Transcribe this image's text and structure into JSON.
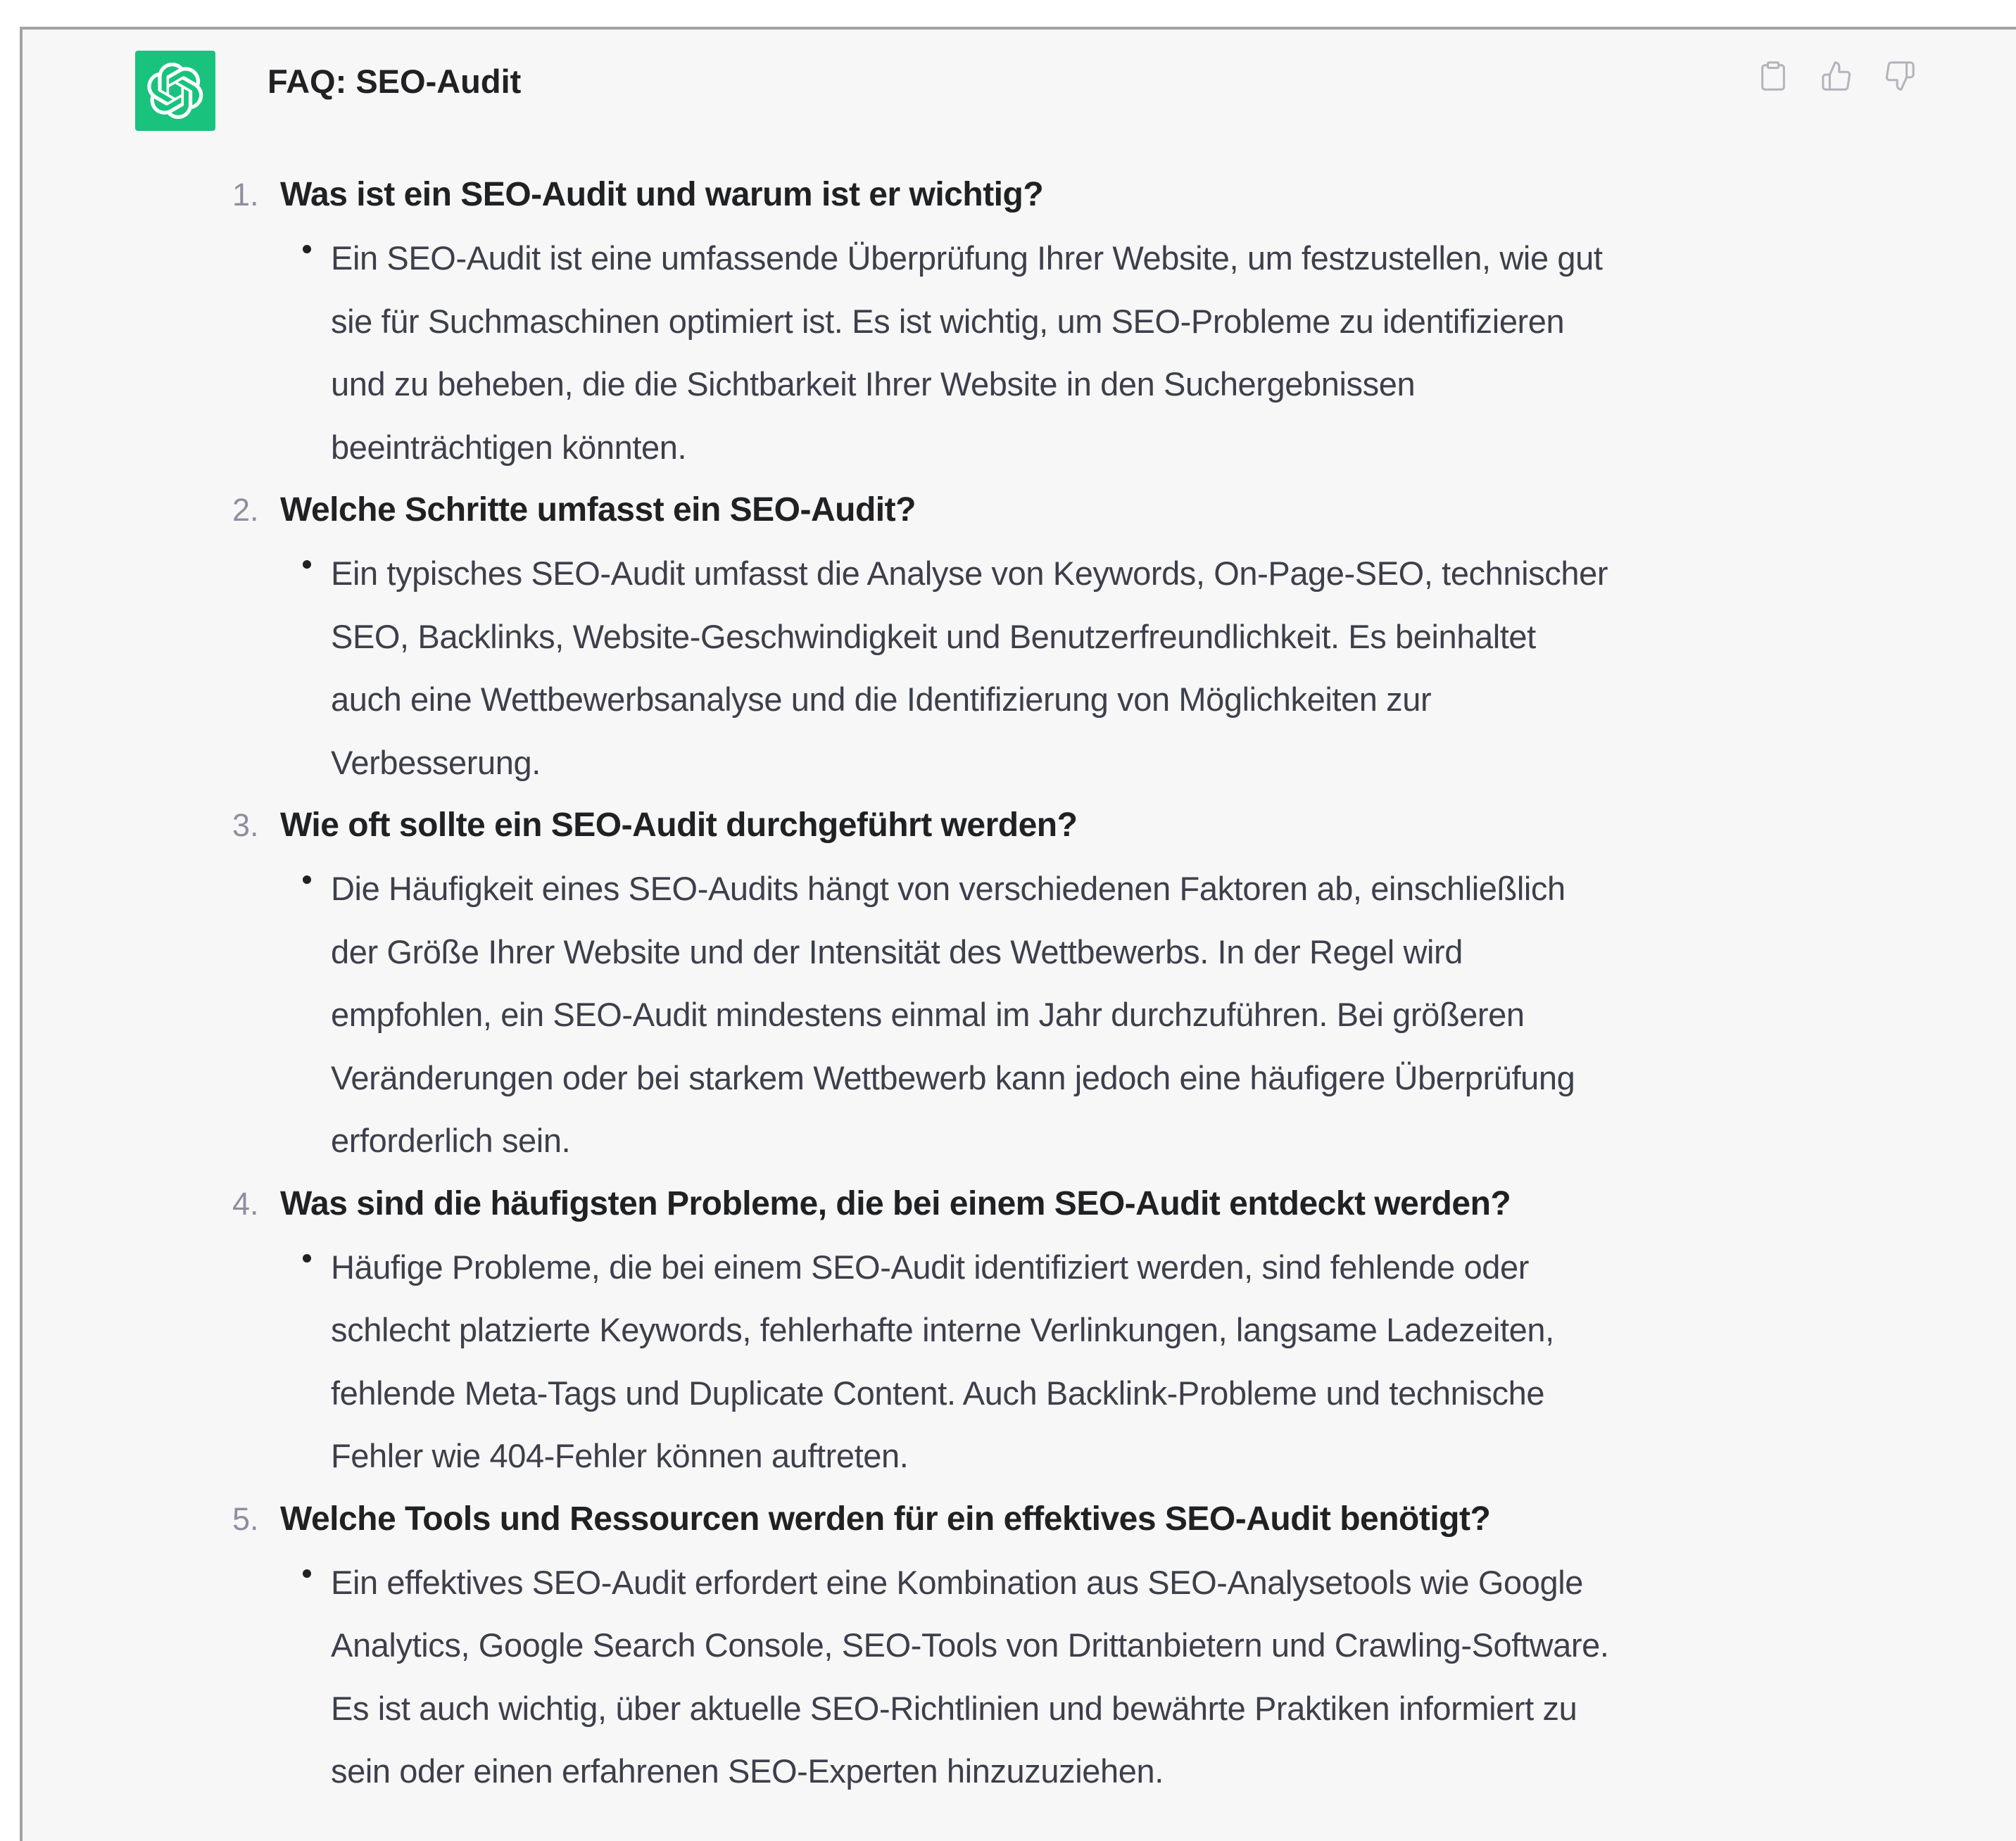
{
  "header": {
    "title": "FAQ: SEO-Audit",
    "avatar_icon": "openai-logo-icon",
    "avatar_color": "#19c37d",
    "actions": [
      {
        "icon": "clipboard-icon"
      },
      {
        "icon": "thumbs-up-icon"
      },
      {
        "icon": "thumbs-down-icon"
      }
    ]
  },
  "faq": [
    {
      "number": "1.",
      "question": "Was ist ein SEO-Audit und warum ist er wichtig?",
      "answer_lines": [
        "Ein SEO-Audit ist eine umfassende Überprüfung Ihrer Website, um festzustellen, wie gut",
        "sie für Suchmaschinen optimiert ist. Es ist wichtig, um SEO-Probleme zu identifizieren",
        "und zu beheben, die die Sichtbarkeit Ihrer Website in den Suchergebnissen",
        "beeinträchtigen könnten."
      ]
    },
    {
      "number": "2.",
      "question": "Welche Schritte umfasst ein SEO-Audit?",
      "answer_lines": [
        "Ein typisches SEO-Audit umfasst die Analyse von Keywords, On-Page-SEO, technischer",
        "SEO, Backlinks, Website-Geschwindigkeit und Benutzerfreundlichkeit. Es beinhaltet",
        "auch eine Wettbewerbsanalyse und die Identifizierung von Möglichkeiten zur",
        "Verbesserung."
      ]
    },
    {
      "number": "3.",
      "question": "Wie oft sollte ein SEO-Audit durchgeführt werden?",
      "answer_lines": [
        "Die Häufigkeit eines SEO-Audits hängt von verschiedenen Faktoren ab, einschließlich",
        "der Größe Ihrer Website und der Intensität des Wettbewerbs. In der Regel wird",
        "empfohlen, ein SEO-Audit mindestens einmal im Jahr durchzuführen. Bei größeren",
        "Veränderungen oder bei starkem Wettbewerb kann jedoch eine häufigere Überprüfung",
        "erforderlich sein."
      ]
    },
    {
      "number": "4.",
      "question": "Was sind die häufigsten Probleme, die bei einem SEO-Audit entdeckt werden?",
      "answer_lines": [
        "Häufige Probleme, die bei einem SEO-Audit identifiziert werden, sind fehlende oder",
        "schlecht platzierte Keywords, fehlerhafte interne Verlinkungen, langsame Ladezeiten,",
        "fehlende Meta-Tags und Duplicate Content. Auch Backlink-Probleme und technische",
        "Fehler wie 404-Fehler können auftreten."
      ]
    },
    {
      "number": "5.",
      "question": "Welche Tools und Ressourcen werden für ein effektives SEO-Audit benötigt?",
      "answer_lines": [
        "Ein effektives SEO-Audit erfordert eine Kombination aus SEO-Analysetools wie Google",
        "Analytics, Google Search Console, SEO-Tools von Drittanbietern und Crawling-Software.",
        "Es ist auch wichtig, über aktuelle SEO-Richtlinien und bewährte Praktiken informiert zu",
        "sein oder einen erfahrenen SEO-Experten hinzuzuziehen."
      ]
    }
  ]
}
